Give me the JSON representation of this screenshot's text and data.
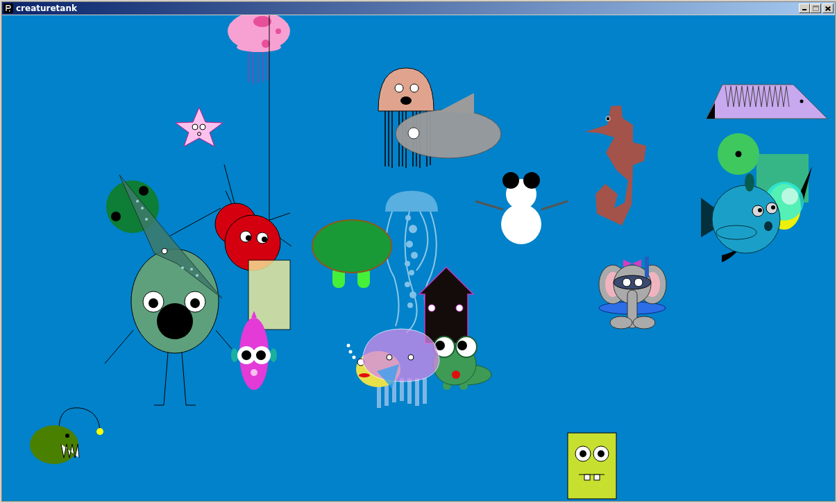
{
  "window": {
    "title": "creaturetank",
    "buttons": [
      {
        "kind": "minimize"
      },
      {
        "kind": "maximize",
        "disabled": true
      },
      {
        "kind": "close"
      }
    ]
  }
}
